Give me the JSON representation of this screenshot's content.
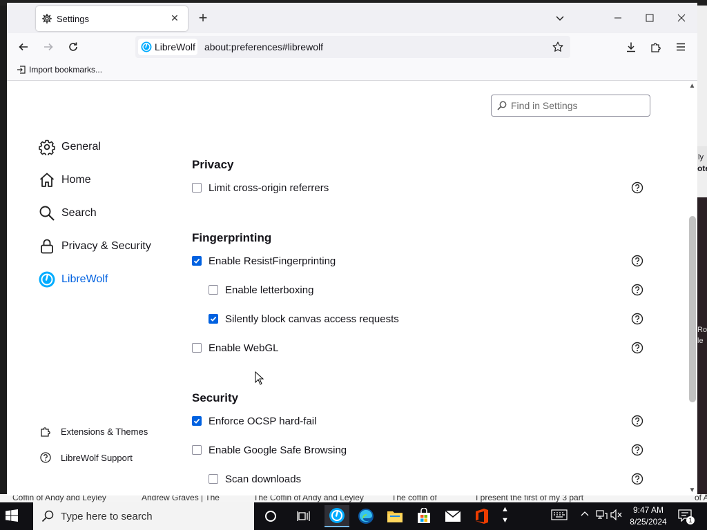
{
  "background": {
    "bottom_titles": [
      "Coffin of Andy and Leyley",
      "Andrew Graves | The",
      "The Coffin of Andy and Leyley",
      "The coffin of",
      "I present the first of my 3 part",
      "of A"
    ],
    "right_fragments": [
      "ly",
      "ote",
      "Rot",
      "le"
    ]
  },
  "browser": {
    "tab": {
      "title": "Settings",
      "close": "✕",
      "new_tab": "+"
    },
    "window_controls": {
      "list_all_tabs": "⌄",
      "minimize": "—",
      "maximize": "☐",
      "close": "✕"
    },
    "identity_label": "LibreWolf",
    "url": "about:preferences#librewolf",
    "bookmarks_toolbar": {
      "import_label": "Import bookmarks..."
    }
  },
  "settings": {
    "find_placeholder": "Find in Settings",
    "categories": [
      {
        "label": "General",
        "icon": "gear-icon"
      },
      {
        "label": "Home",
        "icon": "home-icon"
      },
      {
        "label": "Search",
        "icon": "search-icon"
      },
      {
        "label": "Privacy & Security",
        "icon": "lock-icon"
      },
      {
        "label": "LibreWolf",
        "icon": "librewolf-icon",
        "selected": true
      }
    ],
    "footer_links": [
      {
        "label": "Extensions & Themes",
        "icon": "puzzle-icon"
      },
      {
        "label": "LibreWolf Support",
        "icon": "help-icon"
      }
    ],
    "sections": [
      {
        "heading": "Privacy",
        "options": [
          {
            "label": "Limit cross-origin referrers",
            "checked": false,
            "indent": 0
          }
        ]
      },
      {
        "heading": "Fingerprinting",
        "options": [
          {
            "label": "Enable ResistFingerprinting",
            "checked": true,
            "indent": 0
          },
          {
            "label": "Enable letterboxing",
            "checked": false,
            "indent": 1
          },
          {
            "label": "Silently block canvas access requests",
            "checked": true,
            "indent": 1
          },
          {
            "label": "Enable WebGL",
            "checked": false,
            "indent": 0
          }
        ]
      },
      {
        "heading": "Security",
        "options": [
          {
            "label": "Enforce OCSP hard-fail",
            "checked": true,
            "indent": 0
          },
          {
            "label": "Enable Google Safe Browsing",
            "checked": false,
            "indent": 0
          },
          {
            "label": "Scan downloads",
            "checked": false,
            "indent": 1
          }
        ]
      }
    ]
  },
  "taskbar": {
    "search_placeholder": "Type here to search",
    "apps": [
      "cortana-icon",
      "task-view-icon",
      "librewolf-icon",
      "edge-icon",
      "file-explorer-icon",
      "store-icon",
      "mail-icon",
      "office-icon"
    ],
    "active_app": "librewolf-icon",
    "time": "9:47 AM",
    "date": "8/25/2024",
    "notification_count": "1"
  },
  "colors": {
    "accent": "#0061e0",
    "taskbar": "#101014",
    "tab_strip": "#f0f0f4"
  }
}
